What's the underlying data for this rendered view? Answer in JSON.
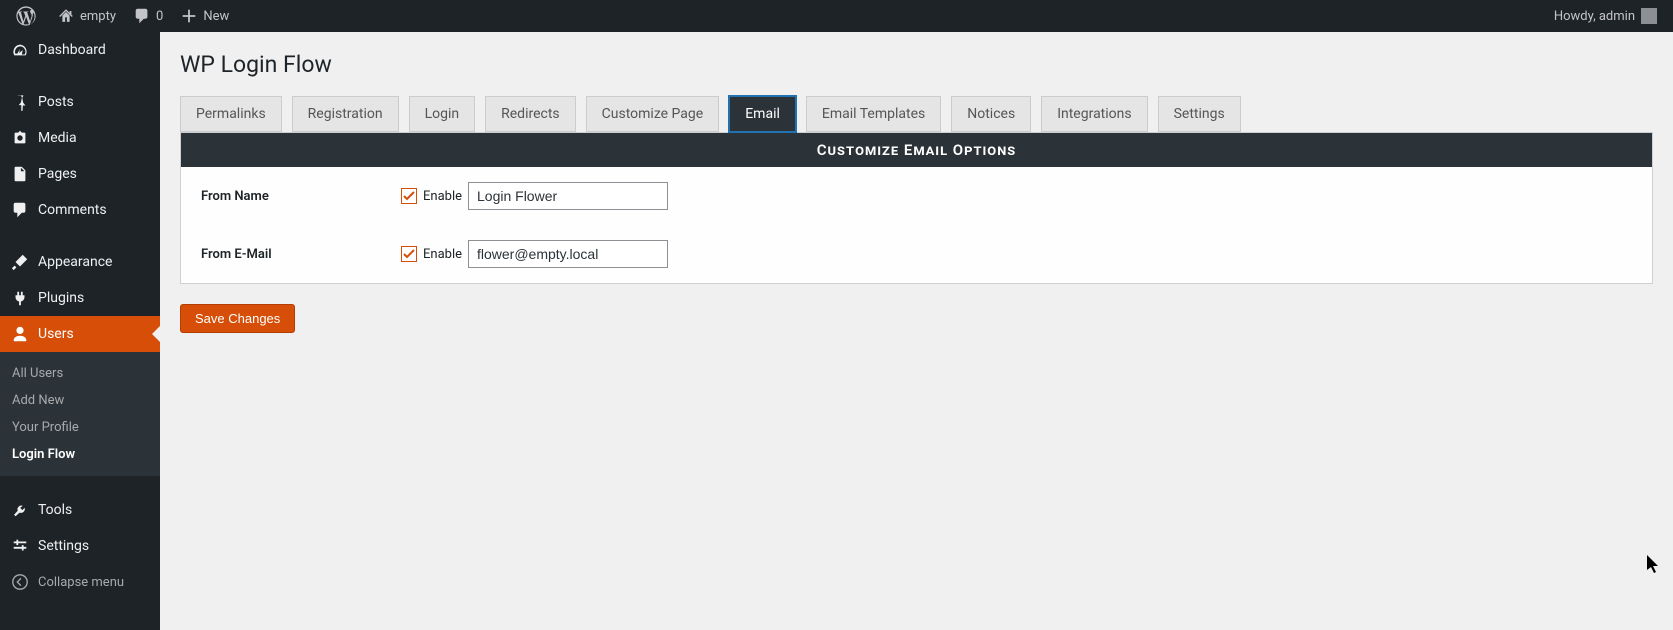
{
  "adminbar": {
    "site_name": "empty",
    "comments_count": "0",
    "new_label": "New",
    "howdy": "Howdy, admin"
  },
  "sidebar": {
    "items": [
      {
        "id": "dashboard",
        "label": "Dashboard",
        "icon": "dashboard"
      },
      {
        "id": "posts",
        "label": "Posts",
        "icon": "pushpin"
      },
      {
        "id": "media",
        "label": "Media",
        "icon": "media"
      },
      {
        "id": "pages",
        "label": "Pages",
        "icon": "page"
      },
      {
        "id": "comments",
        "label": "Comments",
        "icon": "comment"
      },
      {
        "id": "appearance",
        "label": "Appearance",
        "icon": "brush"
      },
      {
        "id": "plugins",
        "label": "Plugins",
        "icon": "plug"
      },
      {
        "id": "users",
        "label": "Users",
        "icon": "user",
        "current": true
      },
      {
        "id": "tools",
        "label": "Tools",
        "icon": "wrench"
      },
      {
        "id": "settings",
        "label": "Settings",
        "icon": "sliders"
      }
    ],
    "submenu": [
      {
        "id": "all-users",
        "label": "All Users"
      },
      {
        "id": "add-new",
        "label": "Add New"
      },
      {
        "id": "your-profile",
        "label": "Your Profile"
      },
      {
        "id": "login-flow",
        "label": "Login Flow",
        "current": true
      }
    ],
    "collapse": "Collapse menu"
  },
  "page": {
    "title": "WP Login Flow"
  },
  "tabs": [
    {
      "id": "permalinks",
      "label": "Permalinks"
    },
    {
      "id": "registration",
      "label": "Registration"
    },
    {
      "id": "login",
      "label": "Login"
    },
    {
      "id": "redirects",
      "label": "Redirects"
    },
    {
      "id": "customize-page",
      "label": "Customize Page"
    },
    {
      "id": "email",
      "label": "Email",
      "active": true
    },
    {
      "id": "email-templates",
      "label": "Email Templates"
    },
    {
      "id": "notices",
      "label": "Notices"
    },
    {
      "id": "integrations",
      "label": "Integrations"
    },
    {
      "id": "settings",
      "label": "Settings"
    }
  ],
  "panel": {
    "heading": "Customize Email Options",
    "rows": [
      {
        "id": "from-name",
        "label": "From Name",
        "enable_label": "Enable",
        "checked": true,
        "value": "Login Flower"
      },
      {
        "id": "from-email",
        "label": "From E-Mail",
        "enable_label": "Enable",
        "checked": true,
        "value": "flower@empty.local"
      }
    ]
  },
  "save_button": "Save Changes"
}
